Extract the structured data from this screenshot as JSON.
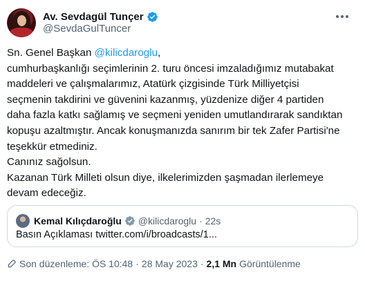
{
  "author": {
    "display_name": "Av. Sevdagül Tunçer",
    "handle": "@SevdaGulTuncer",
    "verified": true
  },
  "tweet": {
    "lines": [
      {
        "pre": "Sn. Genel Başkan ",
        "mention": "@kilicdaroglu",
        "post": ","
      },
      {
        "text": "cumhurbaşkanlığı seçimlerinin 2. turu öncesi imzaladığımız mutabakat"
      },
      {
        "text": "maddeleri ve çalışmalarımız, Atatürk çizgisinde Türk Milliyetçisi"
      },
      {
        "text": "seçmenin takdirini ve güvenini kazanmış, yüzdenize diğer 4 partiden"
      },
      {
        "text": "daha fazla katkı sağlamış ve seçmeni yeniden umutlandırarak sandıktan"
      },
      {
        "text": "kopuşu azaltmıştır. Ancak konuşmanızda sanırım bir tek Zafer Partisi'ne"
      },
      {
        "text": "teşekkür etmediniz."
      },
      {
        "text": "Canınız sağolsun."
      },
      {
        "text": "Kazanan Türk Milleti olsun diye, ilkelerimizden şaşmadan ilerlemeye"
      },
      {
        "text": "devam edeceğiz."
      }
    ]
  },
  "quoted_tweet": {
    "display_name": "Kemal Kılıçdaroğlu",
    "handle": "@kilicdaroglu",
    "separator": "·",
    "time": "22s",
    "text": "Basın Açıklaması twitter.com/i/broadcasts/1..."
  },
  "meta": {
    "edited_label": "Son düzenleme: ÖS 10:48",
    "separator": "·",
    "date": "28 May 2023",
    "views_count": "2,1 Mn",
    "views_label": "Görüntülenme"
  },
  "icons": {
    "verified": "verified-badge-icon",
    "more": "more-options-icon",
    "edit": "pencil-icon"
  },
  "colors": {
    "accent": "#1d9bf0",
    "text_primary": "#0f1419",
    "text_secondary": "#536471",
    "border": "#cfd9de"
  }
}
